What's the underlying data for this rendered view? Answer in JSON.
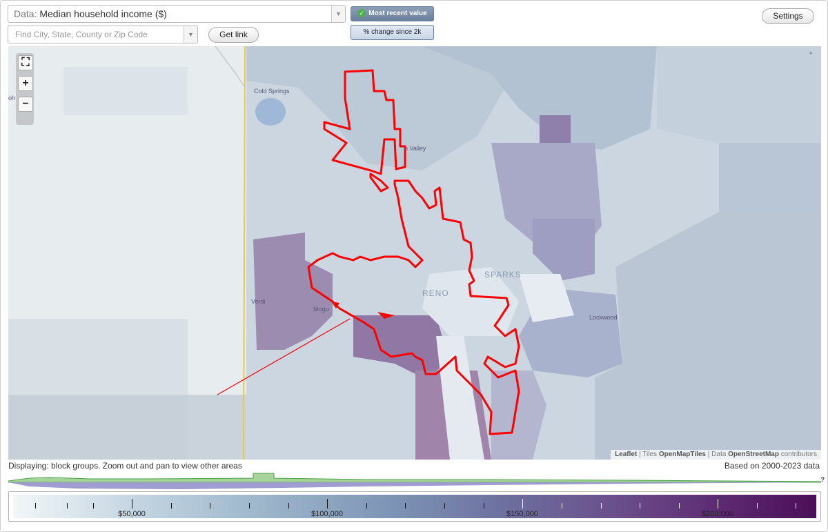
{
  "controls": {
    "data_prefix": "Data:",
    "data_selected": "Median household income ($)",
    "search_placeholder": "Find City, State, County or Zip Code",
    "get_link_label": "Get link",
    "toggle_recent": "Most recent value",
    "toggle_change": "% change since 2k",
    "settings_label": "Settings"
  },
  "map": {
    "labels": {
      "cold_springs": "Cold Springs",
      "sun_valley": "n Valley",
      "verdi": "Verdi",
      "mogul": "Mogu",
      "reno": "RENO",
      "sparks": "SPARKS",
      "lockwood": "Lockwood",
      "edge": "oh"
    },
    "attribution": {
      "leaflet": "Leaflet",
      "tiles_prefix": "Tiles",
      "tiles": "OpenMapTiles",
      "data_prefix": "Data",
      "osm": "OpenStreetMap",
      "contributors": "contributors"
    },
    "boundary_color": "#ff0000",
    "state_line_color": "#e8c84a"
  },
  "footer": {
    "display_note": "Displaying: block groups. Zoom out and pan to view other areas",
    "based_on": "Based on 2000-2023 data",
    "help": "?"
  },
  "legend": {
    "labels": [
      "$50,000",
      "$100,000",
      "$150,000",
      "$200,000"
    ],
    "color_low": "#f2f6f8",
    "color_high": "#4b0f58"
  }
}
